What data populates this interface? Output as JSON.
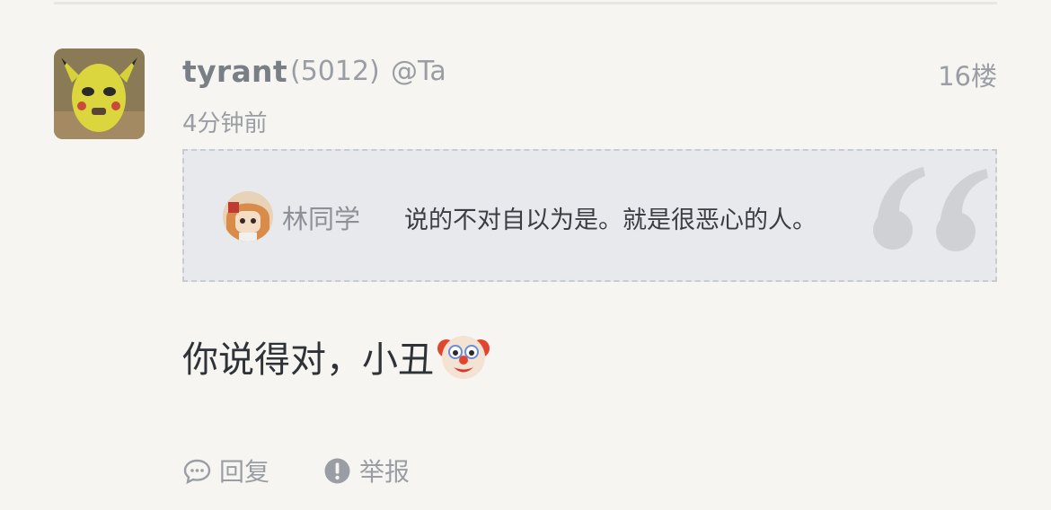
{
  "comment": {
    "author": "tyrant",
    "score": "(5012)",
    "mention": "@Ta",
    "floor": "16楼",
    "time": "4分钟前",
    "body": "你说得对，小丑",
    "body_emoji": "clown-emoji"
  },
  "quote": {
    "author": "林同学",
    "text": "说的不对自以为是。就是很恶心的人。",
    "icon": "quote-mark-icon"
  },
  "actions": {
    "reply_label": "回复",
    "reply_icon": "speech-bubble-icon",
    "report_label": "举报",
    "report_icon": "exclamation-icon"
  },
  "colors": {
    "background": "#f6f5f1",
    "quote_background": "#e7e9ec",
    "muted_text": "#9a9ea4",
    "main_text": "#2f3338"
  }
}
